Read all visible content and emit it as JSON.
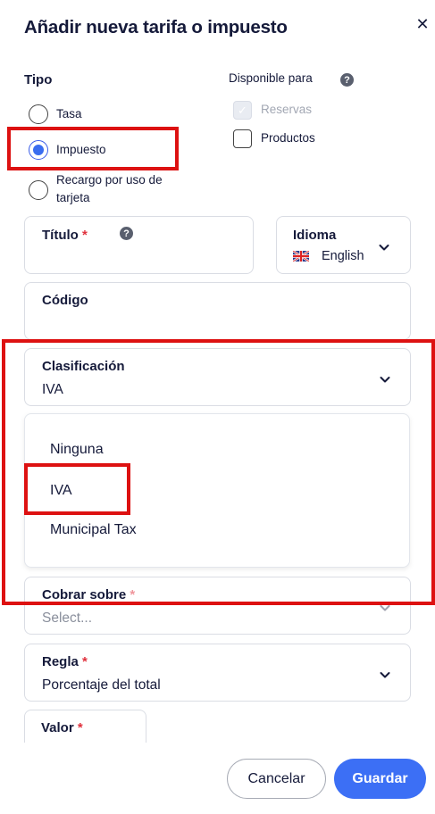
{
  "dialog": {
    "title": "Añadir nueva tarifa o impuesto",
    "close_glyph": "✕"
  },
  "tipo": {
    "label": "Tipo",
    "options": [
      {
        "label": "Tasa",
        "checked": false
      },
      {
        "label": "Impuesto",
        "checked": true
      },
      {
        "label": "Recargo por uso de tarjeta",
        "checked": false
      }
    ]
  },
  "disponible": {
    "label": "Disponible para",
    "help_glyph": "?",
    "options": [
      {
        "label": "Reservas",
        "checked": true,
        "disabled": true
      },
      {
        "label": "Productos",
        "checked": false,
        "disabled": false
      }
    ]
  },
  "titulo": {
    "label": "Título",
    "required_mark": "*",
    "help_glyph": "?",
    "value": ""
  },
  "idioma": {
    "label": "Idioma",
    "value": "English",
    "flag": "uk-flag-icon"
  },
  "codigo": {
    "label": "Código",
    "value": ""
  },
  "clasificacion": {
    "label": "Clasificación",
    "value": "IVA",
    "options": [
      "Ninguna",
      "IVA",
      "Municipal Tax"
    ]
  },
  "cobrar_sobre": {
    "label": "Cobrar sobre",
    "required_mark": "*",
    "placeholder": "Select..."
  },
  "regla": {
    "label": "Regla",
    "required_mark": "*",
    "value": "Porcentaje del total"
  },
  "valor": {
    "label": "Valor",
    "required_mark": "*"
  },
  "footer": {
    "cancel_label": "Cancelar",
    "save_label": "Guardar"
  },
  "colors": {
    "accent": "#3c6ff5",
    "highlight": "#dd1111",
    "required": "#e0303c"
  }
}
